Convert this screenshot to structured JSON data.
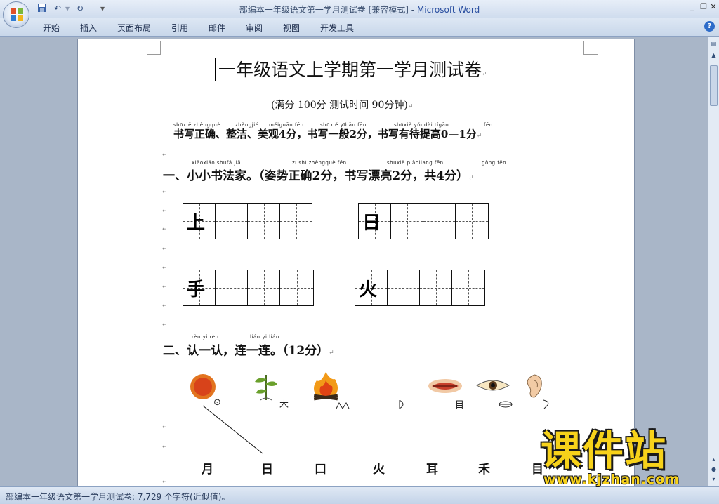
{
  "window": {
    "title_doc": "部编本一年级语文第一学月测试卷 [兼容模式] - ",
    "title_app": "Microsoft Word"
  },
  "qat": {
    "save_icon": "save-icon",
    "undo_icon": "undo-icon",
    "redo_icon": "redo-icon"
  },
  "ribbon": {
    "tabs": [
      "开始",
      "插入",
      "页面布局",
      "引用",
      "邮件",
      "审阅",
      "视图",
      "开发工具"
    ]
  },
  "document": {
    "title": "一年级语文上学期第一学月测试卷",
    "subtitle": "(满分 100分    测试时间 90分钟)",
    "scoring_pinyin": [
      "shūxiě zhèngquè",
      "zhěngjié",
      "měiguān fēn",
      "shūxiě yībān fēn",
      "shūxiě yǒudài tígāo",
      "fēn"
    ],
    "scoring_line": "书写正确、整洁、美观4分，书写一般2分，书写有待提高0—1分",
    "section1_pinyin": [
      "xiǎoxiǎo shūfǎ jiā",
      "zī shì zhèngquè  fēn",
      "shūxiě piàoliang  fēn",
      "gòng  fēn"
    ],
    "section1_heading": "一、小小书法家。（姿势正确2分，书写漂亮2分，共4分）",
    "grid_chars": [
      "上",
      "日",
      "手",
      "火"
    ],
    "section2_pinyin": [
      "rèn yi rèn",
      "lián yi lián"
    ],
    "section2_heading": "二、认一认，连一连。（12分）",
    "picture_glyphs": [
      "⊙",
      "木",
      "",
      "",
      "目",
      "",
      ""
    ],
    "answer_chars": [
      "月",
      "日",
      "口",
      "火",
      "耳",
      "禾",
      "目"
    ],
    "para_mark": "↵"
  },
  "status": {
    "text": "部编本一年级语文第一学月测试卷: 7,729 个字符(近似值)。"
  },
  "watermark": {
    "main": "课件站",
    "url": "www.kjzhan.com"
  }
}
